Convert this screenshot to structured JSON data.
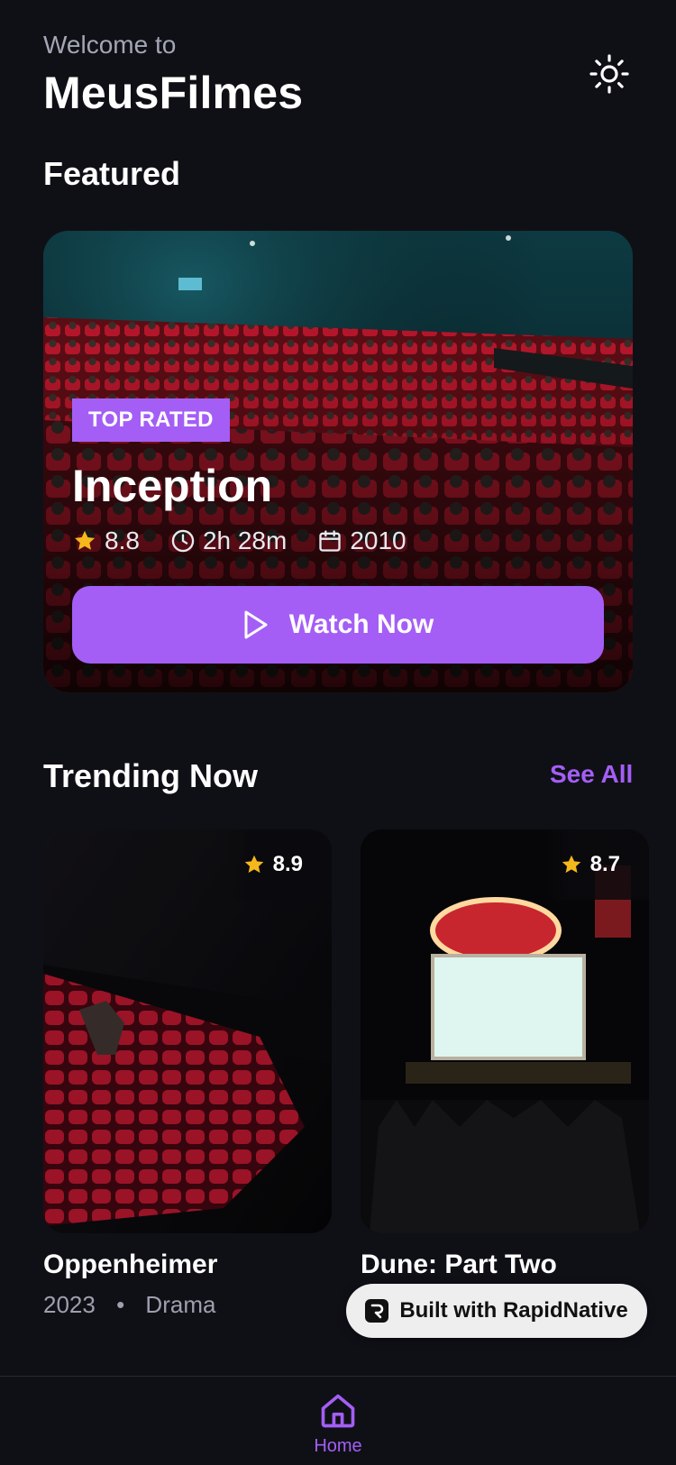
{
  "header": {
    "welcome": "Welcome to",
    "app_name": "MeusFilmes"
  },
  "featured": {
    "heading": "Featured",
    "badge": "TOP RATED",
    "title": "Inception",
    "rating": "8.8",
    "duration": "2h 28m",
    "year": "2010",
    "cta": "Watch Now"
  },
  "trending": {
    "heading": "Trending Now",
    "see_all": "See All",
    "items": [
      {
        "title": "Oppenheimer",
        "rating": "8.9",
        "year": "2023",
        "genre": "Drama"
      },
      {
        "title": "Dune: Part Two",
        "rating": "8.7"
      }
    ]
  },
  "promo": {
    "label": "Built with RapidNative"
  },
  "tabs": [
    {
      "label": "Home"
    }
  ],
  "colors": {
    "accent": "#a45ef5",
    "background": "#0f1016",
    "star": "#f5b81c"
  },
  "icons": [
    "sun-icon",
    "star-icon",
    "clock-icon",
    "calendar-icon",
    "play-icon",
    "home-icon"
  ]
}
